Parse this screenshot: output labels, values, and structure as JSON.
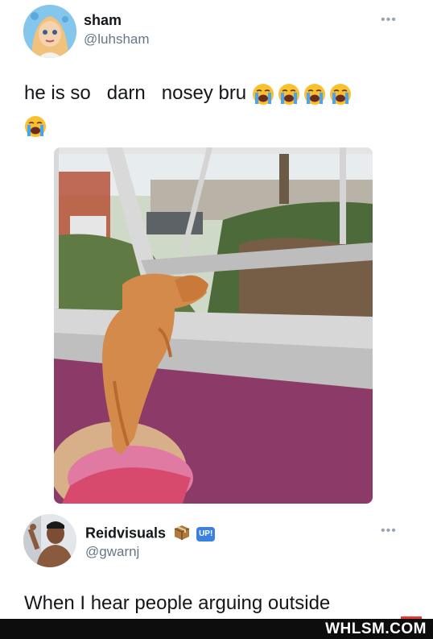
{
  "tweet1": {
    "name": "sham",
    "handle": "@luhsham",
    "more_label": "•••",
    "text_line1": "he is so   darn   nosey bru",
    "emoji_count_line1": 4,
    "emoji_count_line2": 1,
    "emoji_name": "loudly-crying-face"
  },
  "tweet2": {
    "name": "Reidvisuals",
    "badge_box_icon": "package-emoji",
    "badge_up_label": "UP!",
    "handle": "@gwarnj",
    "more_label": "•••",
    "text": "When I hear people arguing outside"
  },
  "watermark": {
    "text": "WHLSM.COM"
  }
}
